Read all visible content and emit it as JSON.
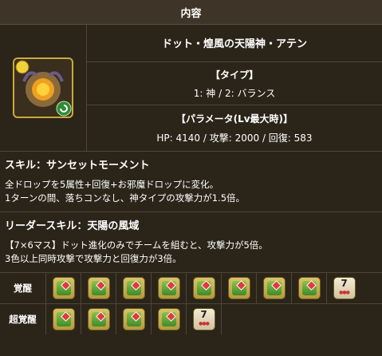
{
  "header": {
    "title": "内容"
  },
  "monster": {
    "name": "ドット・煌風の天陽神・アテン",
    "type_heading": "【タイプ】",
    "types": "1: 神 / 2: バランス",
    "param_heading": "【パラメータ(Lv最大時)】",
    "params": "HP: 4140 / 攻撃: 2000 / 回復: 583"
  },
  "skill": {
    "title": "スキル：サンセットモーメント",
    "line1": "全ドロップを5属性+回復+お邪魔ドロップに変化。",
    "line2": "1ターンの間、落ちコンなし、神タイプの攻撃力が1.5倍。"
  },
  "leader": {
    "title": "リーダースキル：天陽の風域",
    "line1": "【7×6マス】ドット進化のみでチームを組むと、攻撃力が5倍。",
    "line2": "3色以上同時攻撃で攻撃力と回復力が3倍。"
  },
  "awakenings": {
    "label": "覚醒",
    "items": [
      "awakening-icon",
      "awakening-icon",
      "awakening-icon",
      "awakening-icon",
      "awakening-icon",
      "awakening-icon",
      "awakening-icon",
      "awakening-icon",
      "seven-combo-icon"
    ]
  },
  "super_awakenings": {
    "label": "超覚醒",
    "items": [
      "awakening-icon",
      "awakening-icon",
      "awakening-icon",
      "awakening-icon",
      "seven-combo-icon"
    ]
  },
  "combo_badge": "7",
  "colors": {
    "background": "#2b2419",
    "header": "#3e3528",
    "border": "#4e4536"
  }
}
